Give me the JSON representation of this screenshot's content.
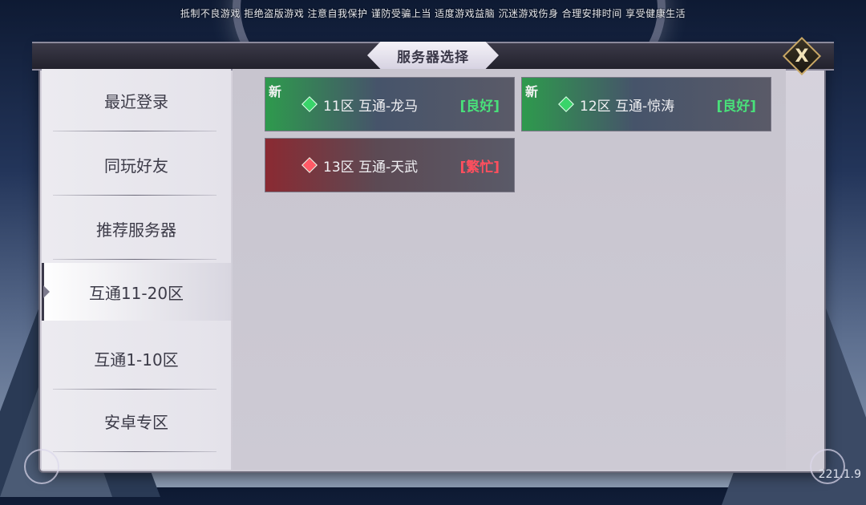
{
  "notice": "抵制不良游戏 拒绝盗版游戏 注意自我保护 谨防受骗上当 适度游戏益脑 沉迷游戏伤身 合理安排时间 享受健康生活",
  "dialog": {
    "title": "服务器选择",
    "close_label": "X"
  },
  "sidebar": {
    "items": [
      {
        "label": "最近登录",
        "active": false
      },
      {
        "label": "同玩好友",
        "active": false
      },
      {
        "label": "推荐服务器",
        "active": false
      },
      {
        "label": "互通11-20区",
        "active": true
      },
      {
        "label": "互通1-10区",
        "active": false
      },
      {
        "label": "安卓专区",
        "active": false
      }
    ]
  },
  "servers": [
    {
      "tag": "新",
      "name": "11区 互通-龙马",
      "status": "[良好]",
      "state": "good",
      "status_color": "#49e07a"
    },
    {
      "tag": "新",
      "name": "12区 互通-惊涛",
      "status": "[良好]",
      "state": "good",
      "status_color": "#49e07a"
    },
    {
      "tag": "",
      "name": "13区 互通-天武",
      "status": "[繁忙]",
      "state": "busy",
      "status_color": "#ff4f5e"
    }
  ],
  "version": "221.1.9",
  "colors": {
    "good": "#49e07a",
    "busy": "#ff4f5e",
    "panel": "#d6d3dd"
  }
}
